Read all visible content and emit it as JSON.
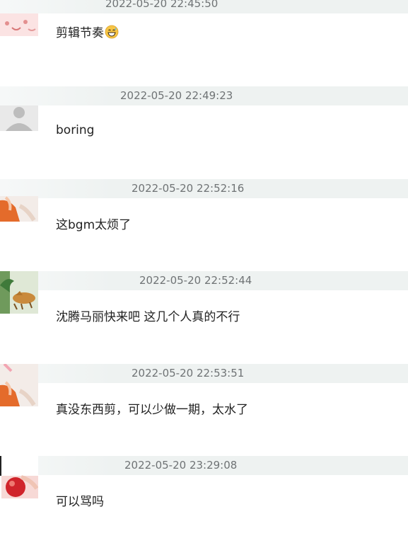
{
  "comments": [
    {
      "timestamp": "2022-05-20 22:45:50",
      "text": "剪辑节奏",
      "emoji": "grinning-sweat-emoji",
      "avatar": "pink-face-avatar"
    },
    {
      "timestamp": "2022-05-20 22:49:23",
      "text": "boring",
      "avatar": "default-gray-avatar"
    },
    {
      "timestamp": "2022-05-20 22:52:16",
      "text": "这bgm太烦了",
      "avatar": "orange-figure-avatar"
    },
    {
      "timestamp": "2022-05-20 22:52:44",
      "text": "沈腾马丽快来吧 这几个人真的不行",
      "avatar": "tiger-painting-avatar"
    },
    {
      "timestamp": "2022-05-20 22:53:51",
      "text": "真没东西剪，可以少做一期，太水了",
      "avatar": "orange-figure-avatar"
    },
    {
      "timestamp": "2022-05-20 23:29:08",
      "text": "可以骂吗",
      "avatar": "red-apple-avatar"
    }
  ]
}
